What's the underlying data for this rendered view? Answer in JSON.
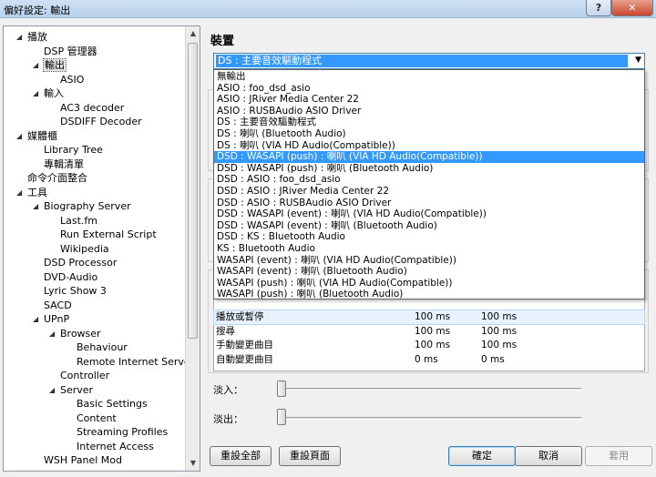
{
  "window": {
    "title": "偏好設定: 輸出",
    "help_label": "?",
    "close_label": "✕"
  },
  "tree": {
    "items": [
      {
        "label": "播放",
        "expander": "◢"
      },
      {
        "label": "DSP 管理器"
      },
      {
        "label": "輸出",
        "expander": "◢"
      },
      {
        "label": "ASIO"
      },
      {
        "label": "輸入",
        "expander": "◢"
      },
      {
        "label": "AC3 decoder"
      },
      {
        "label": "DSDIFF Decoder"
      },
      {
        "label": "媒體櫃",
        "expander": "◢"
      },
      {
        "label": "Library Tree"
      },
      {
        "label": "專輯清單"
      },
      {
        "label": "命令介面整合"
      },
      {
        "label": "工具",
        "expander": "◢"
      },
      {
        "label": "Biography Server",
        "expander": "◢"
      },
      {
        "label": "Last.fm"
      },
      {
        "label": "Run External Script"
      },
      {
        "label": "Wikipedia"
      },
      {
        "label": "DSD Processor"
      },
      {
        "label": "DVD-Audio"
      },
      {
        "label": "Lyric Show 3"
      },
      {
        "label": "SACD"
      },
      {
        "label": "UPnP",
        "expander": "◢"
      },
      {
        "label": "Browser",
        "expander": "◢"
      },
      {
        "label": "Behaviour"
      },
      {
        "label": "Remote Internet Servers"
      },
      {
        "label": "Controller"
      },
      {
        "label": "Server",
        "expander": "◢"
      },
      {
        "label": "Basic Settings"
      },
      {
        "label": "Content"
      },
      {
        "label": "Streaming Profiles"
      },
      {
        "label": "Internet Access"
      },
      {
        "label": "WSH Panel Mod"
      }
    ],
    "selected_label": "輸出"
  },
  "device": {
    "section_title": "裝置",
    "selected": "DS : 主要音效驅動程式",
    "options": [
      "無輸出",
      "ASIO : foo_dsd_asio",
      "ASIO : JRiver Media Center 22",
      "ASIO : RUSBAudio ASIO Driver",
      "DS : 主要音效驅動程式",
      "DS : 喇叭 (Bluetooth Audio)",
      "DS : 喇叭 (VIA HD Audio(Compatible))",
      "DSD : WASAPI (push) : 喇叭 (VIA HD Audio(Compatible))",
      "DSD : WASAPI (push) : 喇叭 (Bluetooth Audio)",
      "DSD : ASIO : foo_dsd_asio",
      "DSD : ASIO : JRiver Media Center 22",
      "DSD : ASIO : RUSBAudio ASIO Driver",
      "DSD : WASAPI (event) : 喇叭 (VIA HD Audio(Compatible))",
      "DSD : WASAPI (event) : 喇叭 (Bluetooth Audio)",
      "DSD : KS : Bluetooth Audio",
      "KS : Bluetooth Audio",
      "WASAPI (event) : 喇叭 (VIA HD Audio(Compatible))",
      "WASAPI (event) : 喇叭 (Bluetooth Audio)",
      "WASAPI (push) : 喇叭 (VIA HD Audio(Compatible))",
      "WASAPI (push) : 喇叭 (Bluetooth Audio)"
    ],
    "highlighted_option": "DSD : WASAPI (push) : 喇叭 (VIA HD Audio(Compatible))",
    "arrow": "▼"
  },
  "fade_table": {
    "rows": [
      {
        "name": "播放或暫停",
        "in": "100 ms",
        "out": "100 ms"
      },
      {
        "name": "搜尋",
        "in": "100 ms",
        "out": "100 ms"
      },
      {
        "name": "手動變更曲目",
        "in": "100 ms",
        "out": "100 ms"
      },
      {
        "name": "自動變更曲目",
        "in": "0 ms",
        "out": "0 ms"
      }
    ]
  },
  "sliders": {
    "fade_in_label": "淡入：",
    "fade_out_label": "淡出：",
    "fade_in_level": 0,
    "fade_out_level": 0
  },
  "buttons": {
    "reset_all": "重設全部",
    "reset_page": "重設頁面",
    "ok": "確定",
    "cancel": "取消",
    "apply": "套用"
  }
}
